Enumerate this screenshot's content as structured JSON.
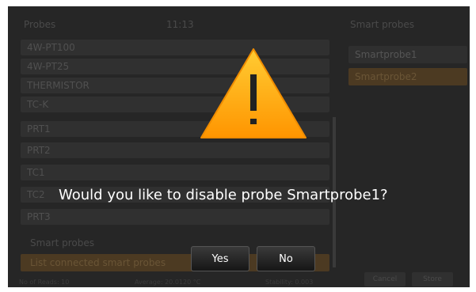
{
  "left_panel": {
    "title": "Probes",
    "time": "11:13",
    "items": [
      "4W-PT100",
      "4W-PT25",
      "THERMISTOR",
      "TC-K",
      "PRT1",
      "PRT2",
      "TC1",
      "TC2",
      "PRT3"
    ],
    "smart_label": "Smart probes",
    "list_button": "List connected smart probes"
  },
  "right_panel": {
    "title": "Smart probes",
    "items": [
      "Smartprobe1",
      "Smartprobe2"
    ]
  },
  "status_bar": {
    "reads": "No of Reads: 10",
    "average": "Average: 20.0120 °C",
    "stability": "Stability: 0.003"
  },
  "bottom_buttons": {
    "cancel": "Cancel",
    "store": "Store"
  },
  "dialog": {
    "message": "Would you like to disable probe Smartprobe1?",
    "yes": "Yes",
    "no": "No"
  },
  "colors": {
    "warning_fill": "#FFA500",
    "background": "#262626",
    "selected_item": "#4c3a22"
  }
}
